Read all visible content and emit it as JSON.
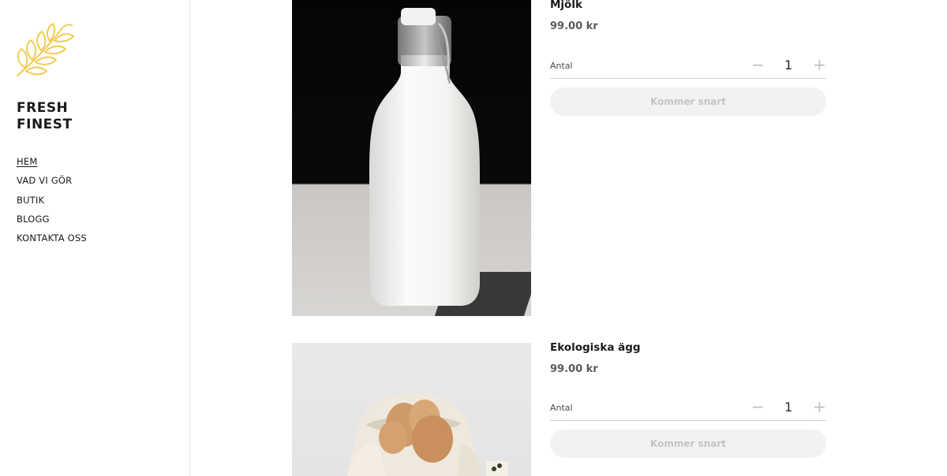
{
  "brand": {
    "line1": "FRESH",
    "line2": "FINEST",
    "logo_icon": "wheat-icon",
    "logo_color": "#f0cc55"
  },
  "nav": {
    "items": [
      {
        "label": "HEM",
        "active": true
      },
      {
        "label": "VAD VI GÖR"
      },
      {
        "label": "BUTIK"
      },
      {
        "label": "BLOGG"
      },
      {
        "label": "KONTAKTA OSS"
      }
    ]
  },
  "products": [
    {
      "name": "Mjölk",
      "price": "99.00 kr",
      "qty_label": "Antal",
      "qty_value": "1",
      "minus": "−",
      "plus": "+",
      "button": "Kommer snart",
      "image_icon": "milk-bottle-photo"
    },
    {
      "name": "Ekologiska ägg",
      "price": "99.00 kr",
      "qty_label": "Antal",
      "qty_value": "1",
      "minus": "−",
      "plus": "+",
      "button": "Kommer snart",
      "image_icon": "eggs-in-bag-photo"
    }
  ]
}
